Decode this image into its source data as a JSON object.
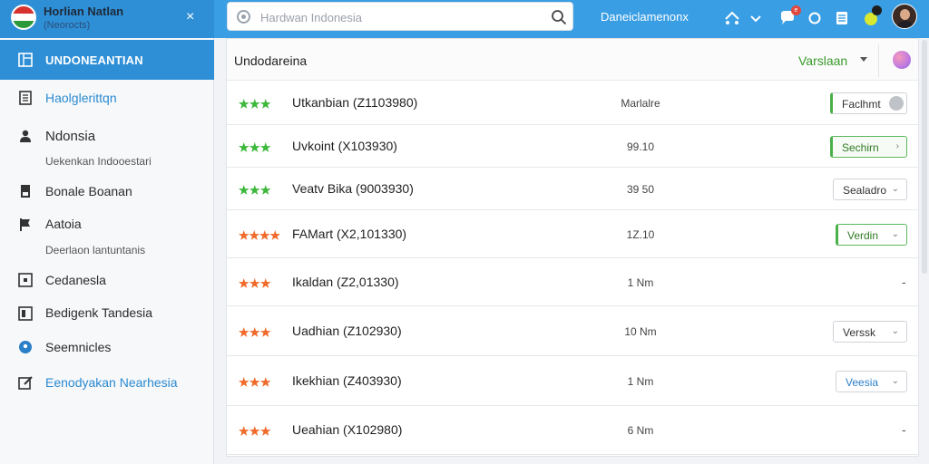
{
  "brand": {
    "title": "Horlian Natlan",
    "subtitle": "(Neorocts)",
    "close_icon": "×"
  },
  "search": {
    "placeholder": "Hardwan Indonesia"
  },
  "topbar": {
    "link": "Daneiclamenonx",
    "icons": [
      "home-network-icon",
      "chevron-down-icon",
      "chat-icon",
      "circle-icon",
      "list-icon",
      "alert-icon"
    ],
    "notif_badge": "e"
  },
  "sidebar": {
    "active_label": "UNDONEANTIAN",
    "items": [
      {
        "label": "Haolglerittqn",
        "icon": "document-icon",
        "highlight": true
      },
      {
        "label": "Ndonsia",
        "icon": "user-icon",
        "highlight": false
      },
      {
        "label": "Uekenkan Indooestari",
        "sub": true
      },
      {
        "label": "Bonale Boanan",
        "icon": "book-icon",
        "highlight": false
      },
      {
        "label": "Aatoia",
        "icon": "flag-icon",
        "highlight": false
      },
      {
        "label": "Deerlaon lantuntanis",
        "sub": true
      },
      {
        "label": "Cedanesla",
        "icon": "box-icon",
        "highlight": false
      },
      {
        "label": "Bedigenk Tandesia",
        "icon": "panel-icon",
        "highlight": false
      },
      {
        "label": "Seemnicles",
        "icon": "location-icon",
        "highlight": false
      },
      {
        "label": "Eenodyakan Nearhesia",
        "icon": "edit-icon",
        "highlight": true
      }
    ]
  },
  "main": {
    "title": "Undodareina",
    "select_label": "Varslaan",
    "rows": [
      {
        "stars": 3,
        "star_color": "#3cb83a",
        "name": "Utkanbian (Z1103980)",
        "value": "Marlalre",
        "action": {
          "label": "Faclhmt",
          "style": "toggle"
        }
      },
      {
        "stars": 3,
        "star_color": "#3cb83a",
        "name": "Uvkoint (X103930)",
        "value": "99.10",
        "action": {
          "label": "Sechirn",
          "style": "green"
        }
      },
      {
        "stars": 3,
        "star_color": "#3cb83a",
        "name": "Veatv Bika (9003930)",
        "value": "39 50",
        "action": {
          "label": "Sealadro",
          "style": "plain"
        }
      },
      {
        "stars": 4,
        "star_color": "#f06a2a",
        "name": "FAMart (X2,101330)",
        "value": "1Z.10",
        "action": {
          "label": "Verdin",
          "style": "green-soft"
        }
      },
      {
        "stars": 3,
        "star_color": "#f06a2a",
        "name": "Ikaldan (Z2,01330)",
        "value": "1 Nm",
        "action": {
          "label": "-",
          "style": "dash"
        }
      },
      {
        "stars": 3,
        "star_color": "#f06a2a",
        "name": "Uadhian (Z102930)",
        "value": "10 Nm",
        "action": {
          "label": "Verssk",
          "style": "plain"
        }
      },
      {
        "stars": 3,
        "star_color": "#f06a2a",
        "name": "Ikekhian (Z403930)",
        "value": "1 Nm",
        "action": {
          "label": "Veesia",
          "style": "plain-blue"
        }
      },
      {
        "stars": 3,
        "star_color": "#f06a2a",
        "name": "Ueahian (X102980)",
        "value": "6 Nm",
        "action": {
          "label": "-",
          "style": "dash"
        }
      }
    ]
  }
}
